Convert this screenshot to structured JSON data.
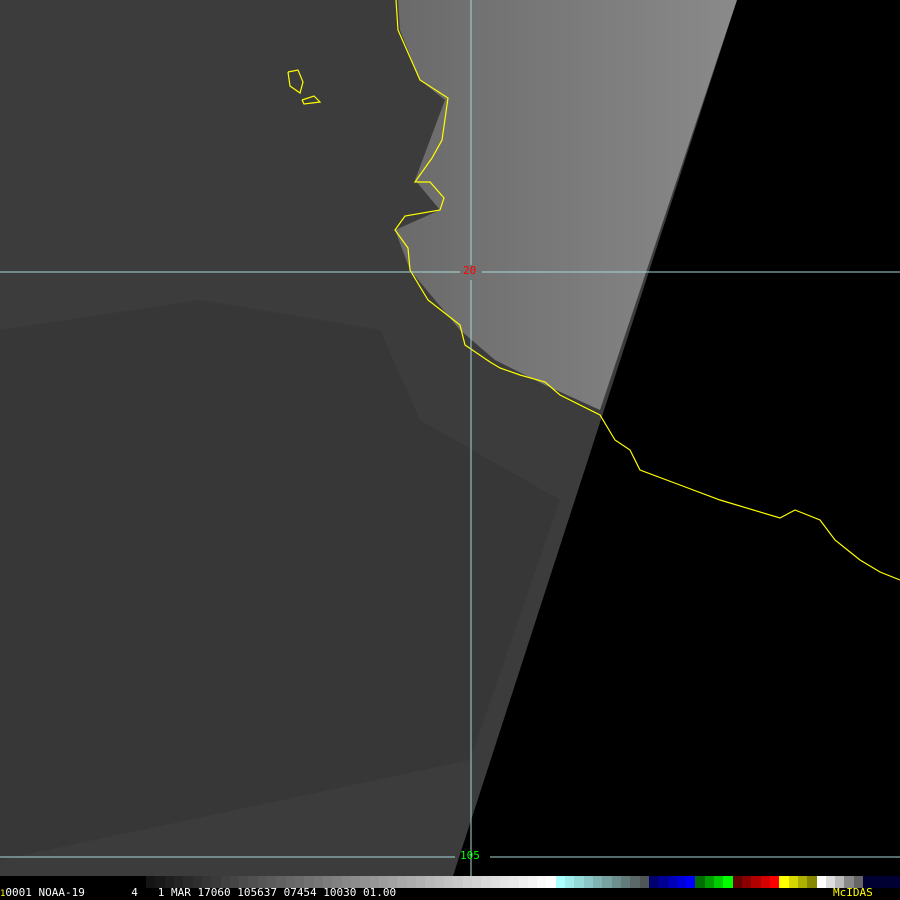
{
  "image": {
    "satellite_info": {
      "frame_number": "1",
      "text": "0001 NOAA-19       4   1 MAR 17060 105637 07454 10030 01.00"
    },
    "latitude_label": "20",
    "longitude_label": "105",
    "brand": "McIDAS",
    "colors": {
      "coast": "#ffff00",
      "grid": "#a8d8d8",
      "lat_label": "#ff0000",
      "lon_label": "#00ff00",
      "brand": "#ffff00"
    }
  }
}
